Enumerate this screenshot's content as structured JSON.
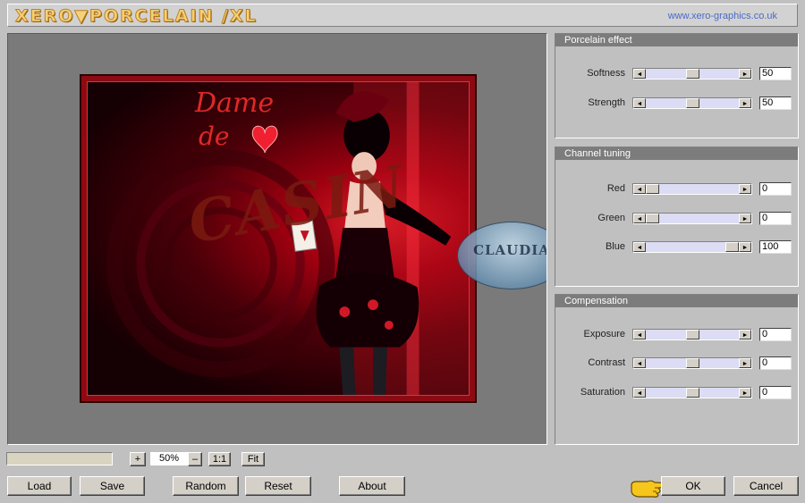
{
  "header": {
    "logo_text": "XERO▼PORCELAIN /XL",
    "website": "www.xero-graphics.co.uk"
  },
  "preview": {
    "overlay_text": [
      "Dame",
      "de",
      "CASIN"
    ],
    "watermark_text": "CLAUDIA"
  },
  "panels": [
    {
      "title": "Porcelain effect",
      "params": [
        {
          "label": "Softness",
          "value": "50",
          "fraction": 0.5
        },
        {
          "label": "Strength",
          "value": "50",
          "fraction": 0.5
        }
      ]
    },
    {
      "title": "Channel tuning",
      "params": [
        {
          "label": "Red",
          "value": "0",
          "fraction": 0.0
        },
        {
          "label": "Green",
          "value": "0",
          "fraction": 0.0
        },
        {
          "label": "Blue",
          "value": "100",
          "fraction": 1.0
        }
      ]
    },
    {
      "title": "Compensation",
      "params": [
        {
          "label": "Exposure",
          "value": "0",
          "fraction": 0.5
        },
        {
          "label": "Contrast",
          "value": "0",
          "fraction": 0.5
        },
        {
          "label": "Saturation",
          "value": "0",
          "fraction": 0.5
        }
      ]
    }
  ],
  "zoom": {
    "plus": "+",
    "value": "50%",
    "minus": "–",
    "one_to_one": "1:1",
    "fit": "Fit"
  },
  "buttons": {
    "load": "Load",
    "save": "Save",
    "random": "Random",
    "reset": "Reset",
    "about": "About",
    "ok": "OK",
    "cancel": "Cancel"
  },
  "icons": {
    "slider_left": "◄",
    "slider_right": "►",
    "pointer": "pointing-hand-icon"
  }
}
